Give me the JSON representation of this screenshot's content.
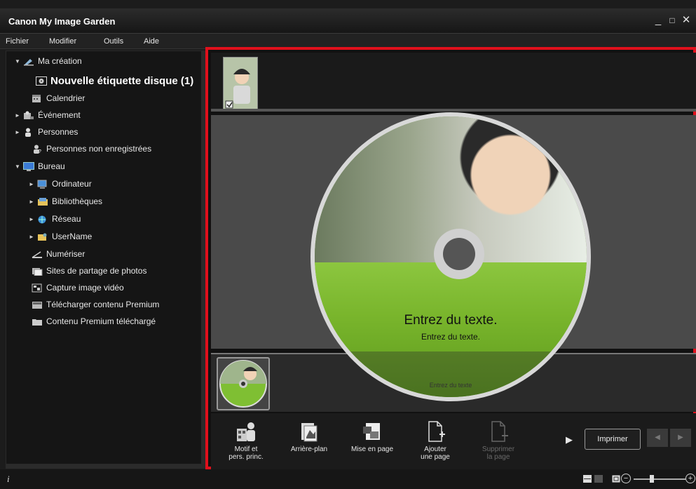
{
  "window": {
    "title": "Canon My Image Garden",
    "minimize": "_",
    "maximize": "□",
    "close": "✕"
  },
  "menu": [
    "Fichier",
    "Modifier",
    "Outils",
    "Aide"
  ],
  "sidebar": {
    "items": [
      {
        "label": "Ma création",
        "arrow": "▼",
        "icon": "my-creation-icon"
      },
      {
        "label": "Nouvelle étiquette disque (1)",
        "arrow": "",
        "icon": "disc-label-icon"
      },
      {
        "label": "Calendrier",
        "arrow": "",
        "icon": "calendar-icon"
      },
      {
        "label": "Événement",
        "arrow": "►",
        "icon": "event-icon"
      },
      {
        "label": "Personnes",
        "arrow": "►",
        "icon": "people-icon"
      },
      {
        "label": "Personnes non enregistrées",
        "arrow": "",
        "icon": "unregistered-people-icon"
      },
      {
        "label": "Bureau",
        "arrow": "▼",
        "icon": "desktop-icon"
      },
      {
        "label": "Ordinateur",
        "arrow": "►",
        "icon": "computer-icon"
      },
      {
        "label": "Bibliothèques",
        "arrow": "►",
        "icon": "libraries-icon"
      },
      {
        "label": "Réseau",
        "arrow": "►",
        "icon": "network-icon"
      },
      {
        "label": "UserName",
        "arrow": "►",
        "icon": "user-folder-icon"
      },
      {
        "label": "Numériser",
        "arrow": "",
        "icon": "scan-icon"
      },
      {
        "label": "Sites de partage de photos",
        "arrow": "",
        "icon": "photo-sharing-icon"
      },
      {
        "label": "Capture image vidéo",
        "arrow": "",
        "icon": "video-capture-icon"
      },
      {
        "label": "Télécharger contenu Premium",
        "arrow": "",
        "icon": "download-premium-icon"
      },
      {
        "label": "Contenu Premium téléchargé",
        "arrow": "",
        "icon": "premium-folder-icon"
      }
    ]
  },
  "disc": {
    "text_main": "Entrez du texte.",
    "text_sub": "Entrez du texte.",
    "text_faint": "Entrez du texte"
  },
  "toolbar": {
    "buttons": [
      {
        "label": "Motif et\npers. princ.",
        "icon": "theme-people-icon",
        "enabled": true
      },
      {
        "label": "Arrière-plan",
        "icon": "background-icon",
        "enabled": true
      },
      {
        "label": "Mise en page",
        "icon": "layout-icon",
        "enabled": true
      },
      {
        "label": "Ajouter\nune page",
        "icon": "add-page-icon",
        "enabled": true
      },
      {
        "label": "Supprimer\nla page",
        "icon": "delete-page-icon",
        "enabled": false
      }
    ],
    "more": "▶",
    "print": "Imprimer",
    "prev": "◀",
    "next": "▶"
  },
  "status": {
    "info": "i",
    "zoom_out": "−",
    "zoom_in": "+"
  },
  "colors": {
    "highlight": "#e0101c",
    "disc_green": "#79b52c",
    "background": "#1c1c1c"
  }
}
